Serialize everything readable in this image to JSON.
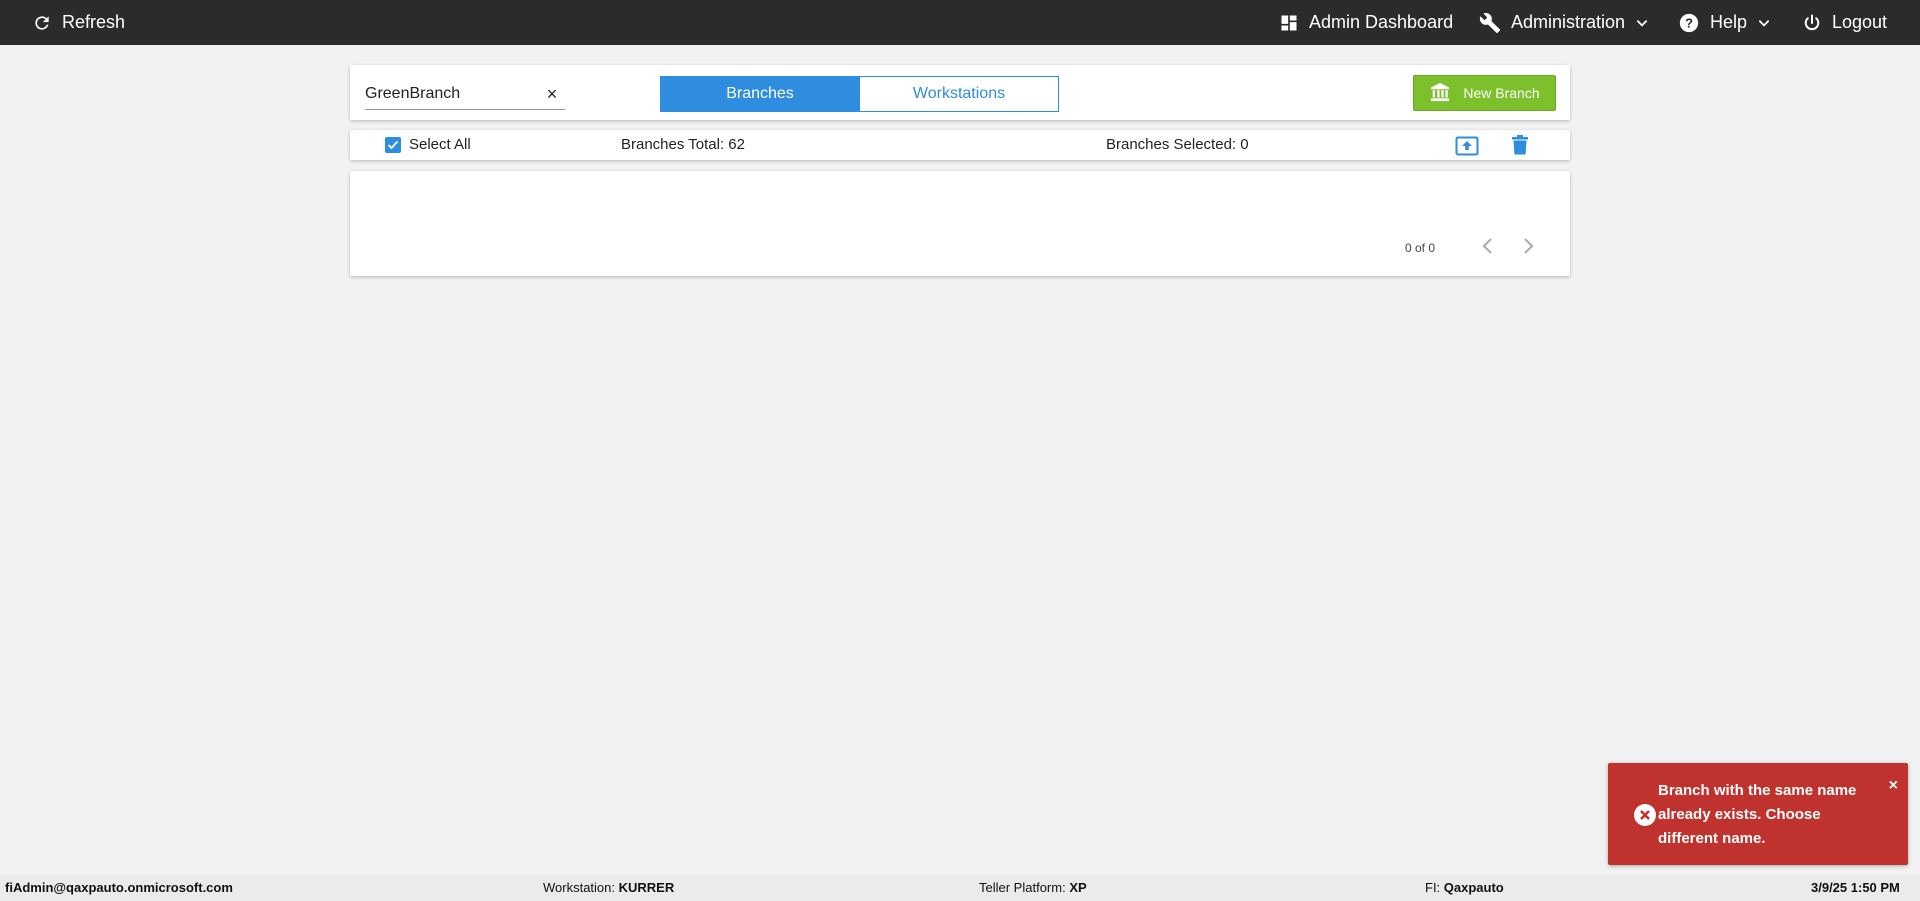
{
  "topbar": {
    "refresh_label": "Refresh",
    "admin_dashboard_label": "Admin Dashboard",
    "administration_label": "Administration",
    "help_label": "Help",
    "logout_label": "Logout"
  },
  "toolbar": {
    "search_value": "GreenBranch",
    "clear_symbol": "×",
    "tabs": [
      {
        "label": "Branches",
        "active": true
      },
      {
        "label": "Workstations",
        "active": false
      }
    ],
    "new_branch_label": "New Branch"
  },
  "selection": {
    "select_all_label": "Select All",
    "select_all_checked": true,
    "total_label": "Branches Total: 62",
    "selected_label": "Branches Selected: 0"
  },
  "pager": {
    "text": "0 of 0"
  },
  "toast": {
    "message": "Branch with the same name already exists. Choose different name.",
    "close_symbol": "×"
  },
  "footer": {
    "user": "fiAdmin@qaxpauto.onmicrosoft.com",
    "workstation_label": "Workstation: ",
    "workstation_value": "KURRER",
    "platform_label": "Teller Platform: ",
    "platform_value": "XP",
    "fi_label": "FI: ",
    "fi_value": "Qaxpauto",
    "datetime": "3/9/25 1:50 PM"
  },
  "colors": {
    "accent": "#2e8ddf",
    "success": "#7cc02b",
    "error": "#c0322d",
    "topbar": "#2b2b2b"
  }
}
